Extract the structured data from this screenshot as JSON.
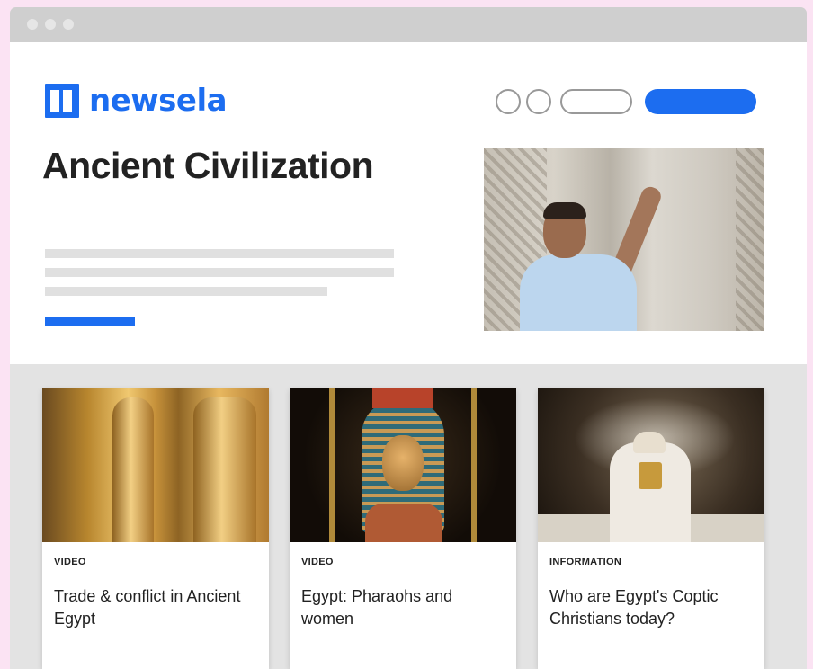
{
  "window": {
    "dots": [
      "window-dot",
      "window-dot",
      "window-dot"
    ]
  },
  "header": {
    "logo_text": "newsela",
    "colors": {
      "brand": "#1c6df0"
    }
  },
  "hero": {
    "title": "Ancient Civilization",
    "image_icon": "photo-icon"
  },
  "cards": [
    {
      "type": "VIDEO",
      "title": "Trade & conflict in Ancient Egypt"
    },
    {
      "type": "VIDEO",
      "title": "Egypt: Pharaohs and women"
    },
    {
      "type": "INFORMATION",
      "title": "Who are Egypt's Coptic Christians today?"
    }
  ]
}
